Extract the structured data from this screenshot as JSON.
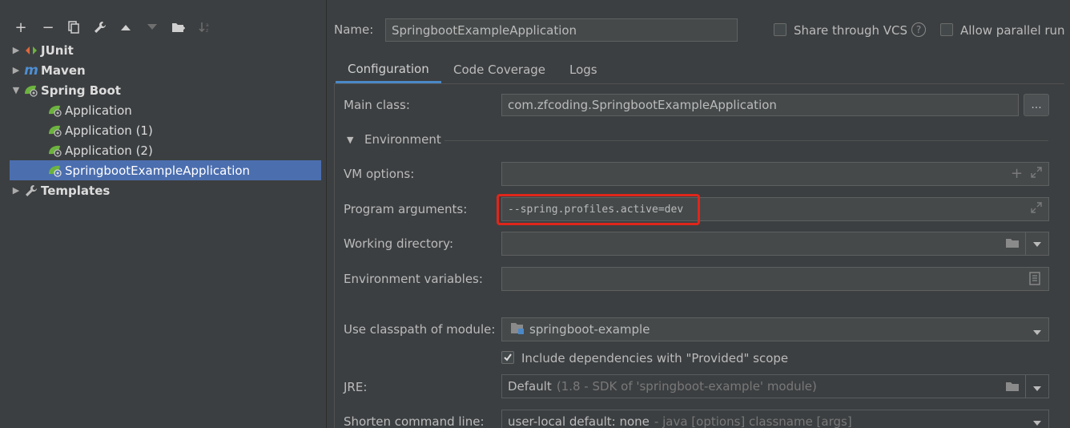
{
  "tree": {
    "items": [
      {
        "label": "JUnit",
        "bold": true
      },
      {
        "label": "Maven",
        "bold": true
      },
      {
        "label": "Spring Boot",
        "bold": true
      },
      {
        "label": "Application"
      },
      {
        "label": "Application (1)"
      },
      {
        "label": "Application (2)"
      },
      {
        "label": "SpringbootExampleApplication"
      },
      {
        "label": "Templates",
        "bold": true
      }
    ]
  },
  "header": {
    "name_label": "Name:",
    "name_value": "SpringbootExampleApplication",
    "share_vcs_label": "Share through VCS",
    "help_glyph": "?",
    "parallel_label": "Allow parallel run"
  },
  "tabs": [
    {
      "label": "Configuration"
    },
    {
      "label": "Code Coverage"
    },
    {
      "label": "Logs"
    }
  ],
  "config": {
    "main_class_label": "Main class:",
    "main_class_value": "com.zfcoding.SpringbootExampleApplication",
    "browse_label": "...",
    "environment_label": "Environment",
    "vm_options_label": "VM options:",
    "program_args_label": "Program arguments:",
    "program_args_value": "--spring.profiles.active=dev",
    "working_dir_label": "Working directory:",
    "env_vars_label": "Environment variables:",
    "classpath_label": "Use classpath of module:",
    "classpath_value": "springboot-example",
    "include_deps_label": "Include dependencies with \"Provided\" scope",
    "jre_label": "JRE:",
    "jre_value": "Default",
    "jre_hint": "(1.8 - SDK of 'springboot-example' module)",
    "shorten_label": "Shorten command line:",
    "shorten_value": "user-local default: none",
    "shorten_hint": "- java [options] classname [args]"
  },
  "colors": {
    "selection": "#4b6eaf",
    "highlight_box": "#e0261b",
    "tab_underline": "#4a88c7",
    "spring_green": "#6db33f"
  }
}
